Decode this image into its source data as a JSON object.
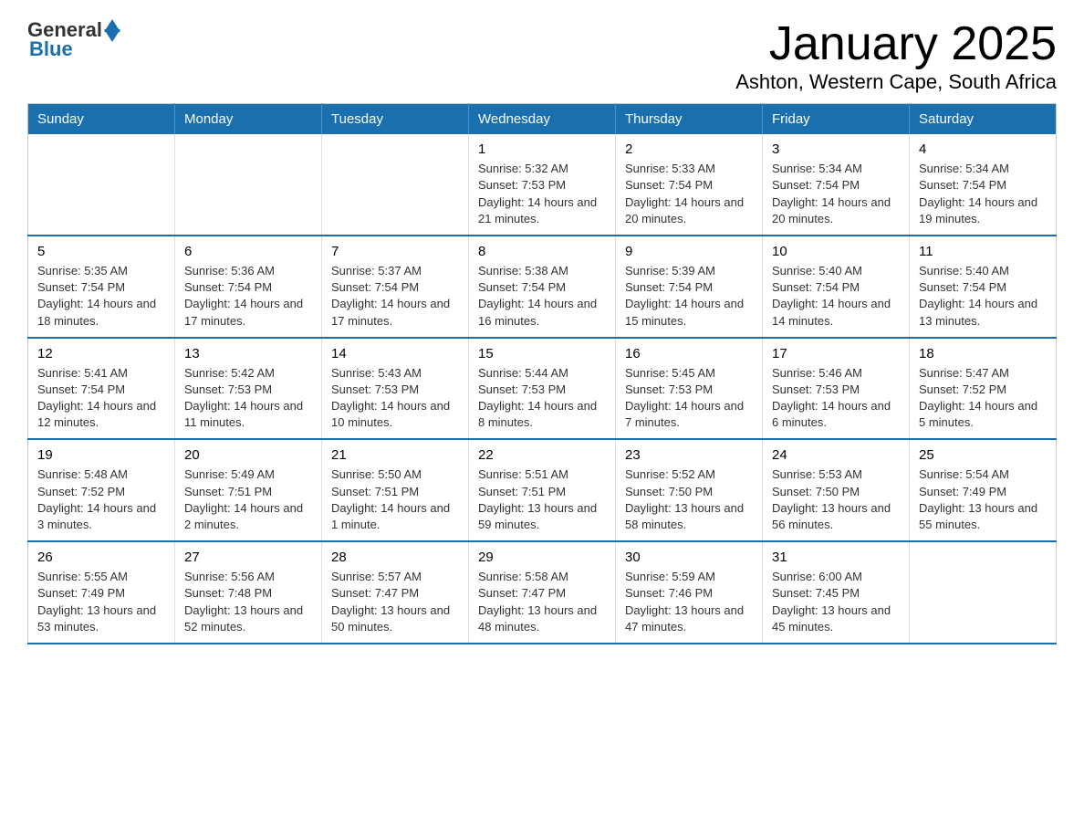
{
  "header": {
    "logo": {
      "general": "General",
      "blue": "Blue"
    },
    "title": "January 2025",
    "subtitle": "Ashton, Western Cape, South Africa"
  },
  "calendar": {
    "weekdays": [
      "Sunday",
      "Monday",
      "Tuesday",
      "Wednesday",
      "Thursday",
      "Friday",
      "Saturday"
    ],
    "weeks": [
      [
        {
          "day": "",
          "sunrise": "",
          "sunset": "",
          "daylight": ""
        },
        {
          "day": "",
          "sunrise": "",
          "sunset": "",
          "daylight": ""
        },
        {
          "day": "",
          "sunrise": "",
          "sunset": "",
          "daylight": ""
        },
        {
          "day": "1",
          "sunrise": "Sunrise: 5:32 AM",
          "sunset": "Sunset: 7:53 PM",
          "daylight": "Daylight: 14 hours and 21 minutes."
        },
        {
          "day": "2",
          "sunrise": "Sunrise: 5:33 AM",
          "sunset": "Sunset: 7:54 PM",
          "daylight": "Daylight: 14 hours and 20 minutes."
        },
        {
          "day": "3",
          "sunrise": "Sunrise: 5:34 AM",
          "sunset": "Sunset: 7:54 PM",
          "daylight": "Daylight: 14 hours and 20 minutes."
        },
        {
          "day": "4",
          "sunrise": "Sunrise: 5:34 AM",
          "sunset": "Sunset: 7:54 PM",
          "daylight": "Daylight: 14 hours and 19 minutes."
        }
      ],
      [
        {
          "day": "5",
          "sunrise": "Sunrise: 5:35 AM",
          "sunset": "Sunset: 7:54 PM",
          "daylight": "Daylight: 14 hours and 18 minutes."
        },
        {
          "day": "6",
          "sunrise": "Sunrise: 5:36 AM",
          "sunset": "Sunset: 7:54 PM",
          "daylight": "Daylight: 14 hours and 17 minutes."
        },
        {
          "day": "7",
          "sunrise": "Sunrise: 5:37 AM",
          "sunset": "Sunset: 7:54 PM",
          "daylight": "Daylight: 14 hours and 17 minutes."
        },
        {
          "day": "8",
          "sunrise": "Sunrise: 5:38 AM",
          "sunset": "Sunset: 7:54 PM",
          "daylight": "Daylight: 14 hours and 16 minutes."
        },
        {
          "day": "9",
          "sunrise": "Sunrise: 5:39 AM",
          "sunset": "Sunset: 7:54 PM",
          "daylight": "Daylight: 14 hours and 15 minutes."
        },
        {
          "day": "10",
          "sunrise": "Sunrise: 5:40 AM",
          "sunset": "Sunset: 7:54 PM",
          "daylight": "Daylight: 14 hours and 14 minutes."
        },
        {
          "day": "11",
          "sunrise": "Sunrise: 5:40 AM",
          "sunset": "Sunset: 7:54 PM",
          "daylight": "Daylight: 14 hours and 13 minutes."
        }
      ],
      [
        {
          "day": "12",
          "sunrise": "Sunrise: 5:41 AM",
          "sunset": "Sunset: 7:54 PM",
          "daylight": "Daylight: 14 hours and 12 minutes."
        },
        {
          "day": "13",
          "sunrise": "Sunrise: 5:42 AM",
          "sunset": "Sunset: 7:53 PM",
          "daylight": "Daylight: 14 hours and 11 minutes."
        },
        {
          "day": "14",
          "sunrise": "Sunrise: 5:43 AM",
          "sunset": "Sunset: 7:53 PM",
          "daylight": "Daylight: 14 hours and 10 minutes."
        },
        {
          "day": "15",
          "sunrise": "Sunrise: 5:44 AM",
          "sunset": "Sunset: 7:53 PM",
          "daylight": "Daylight: 14 hours and 8 minutes."
        },
        {
          "day": "16",
          "sunrise": "Sunrise: 5:45 AM",
          "sunset": "Sunset: 7:53 PM",
          "daylight": "Daylight: 14 hours and 7 minutes."
        },
        {
          "day": "17",
          "sunrise": "Sunrise: 5:46 AM",
          "sunset": "Sunset: 7:53 PM",
          "daylight": "Daylight: 14 hours and 6 minutes."
        },
        {
          "day": "18",
          "sunrise": "Sunrise: 5:47 AM",
          "sunset": "Sunset: 7:52 PM",
          "daylight": "Daylight: 14 hours and 5 minutes."
        }
      ],
      [
        {
          "day": "19",
          "sunrise": "Sunrise: 5:48 AM",
          "sunset": "Sunset: 7:52 PM",
          "daylight": "Daylight: 14 hours and 3 minutes."
        },
        {
          "day": "20",
          "sunrise": "Sunrise: 5:49 AM",
          "sunset": "Sunset: 7:51 PM",
          "daylight": "Daylight: 14 hours and 2 minutes."
        },
        {
          "day": "21",
          "sunrise": "Sunrise: 5:50 AM",
          "sunset": "Sunset: 7:51 PM",
          "daylight": "Daylight: 14 hours and 1 minute."
        },
        {
          "day": "22",
          "sunrise": "Sunrise: 5:51 AM",
          "sunset": "Sunset: 7:51 PM",
          "daylight": "Daylight: 13 hours and 59 minutes."
        },
        {
          "day": "23",
          "sunrise": "Sunrise: 5:52 AM",
          "sunset": "Sunset: 7:50 PM",
          "daylight": "Daylight: 13 hours and 58 minutes."
        },
        {
          "day": "24",
          "sunrise": "Sunrise: 5:53 AM",
          "sunset": "Sunset: 7:50 PM",
          "daylight": "Daylight: 13 hours and 56 minutes."
        },
        {
          "day": "25",
          "sunrise": "Sunrise: 5:54 AM",
          "sunset": "Sunset: 7:49 PM",
          "daylight": "Daylight: 13 hours and 55 minutes."
        }
      ],
      [
        {
          "day": "26",
          "sunrise": "Sunrise: 5:55 AM",
          "sunset": "Sunset: 7:49 PM",
          "daylight": "Daylight: 13 hours and 53 minutes."
        },
        {
          "day": "27",
          "sunrise": "Sunrise: 5:56 AM",
          "sunset": "Sunset: 7:48 PM",
          "daylight": "Daylight: 13 hours and 52 minutes."
        },
        {
          "day": "28",
          "sunrise": "Sunrise: 5:57 AM",
          "sunset": "Sunset: 7:47 PM",
          "daylight": "Daylight: 13 hours and 50 minutes."
        },
        {
          "day": "29",
          "sunrise": "Sunrise: 5:58 AM",
          "sunset": "Sunset: 7:47 PM",
          "daylight": "Daylight: 13 hours and 48 minutes."
        },
        {
          "day": "30",
          "sunrise": "Sunrise: 5:59 AM",
          "sunset": "Sunset: 7:46 PM",
          "daylight": "Daylight: 13 hours and 47 minutes."
        },
        {
          "day": "31",
          "sunrise": "Sunrise: 6:00 AM",
          "sunset": "Sunset: 7:45 PM",
          "daylight": "Daylight: 13 hours and 45 minutes."
        },
        {
          "day": "",
          "sunrise": "",
          "sunset": "",
          "daylight": ""
        }
      ]
    ]
  }
}
